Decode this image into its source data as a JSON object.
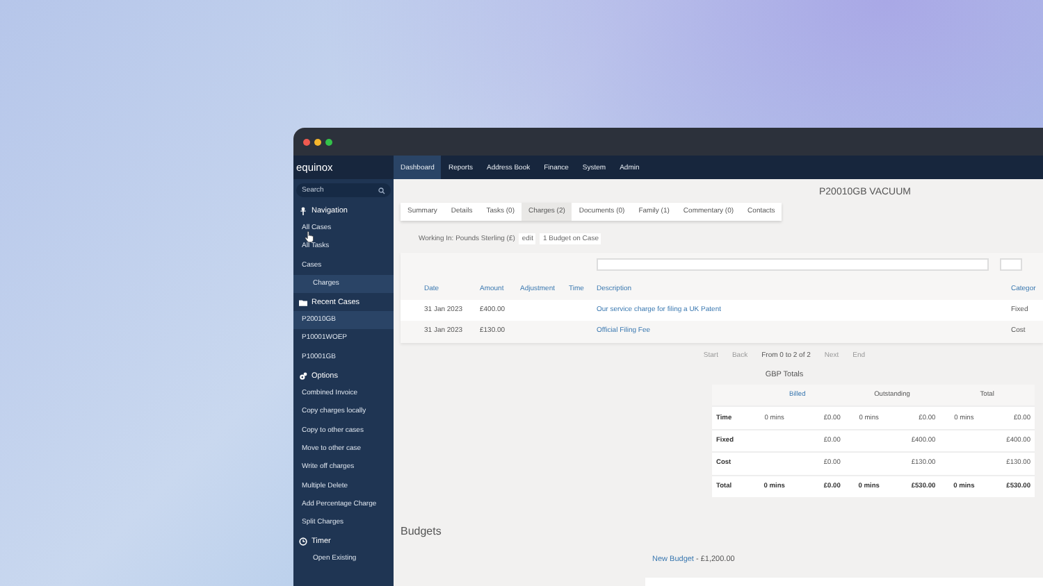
{
  "sidebar": {
    "logo": "equinox",
    "search": {
      "placeholder": "Search"
    },
    "sections": [
      {
        "kind": "navigation",
        "title": "Navigation",
        "items": [
          {
            "label": "All Cases",
            "selected": false,
            "indent": false
          },
          {
            "label": "All Tasks",
            "selected": false,
            "indent": false
          },
          {
            "label": "Cases",
            "selected": false,
            "indent": false
          },
          {
            "label": "Charges",
            "selected": true,
            "indent": true
          }
        ]
      },
      {
        "kind": "folder",
        "title": "Recent Cases",
        "items": [
          {
            "label": "P20010GB",
            "selected": true,
            "indent": false
          },
          {
            "label": "P10001WOEP",
            "selected": false,
            "indent": false
          },
          {
            "label": "P10001GB",
            "selected": false,
            "indent": false
          }
        ]
      },
      {
        "kind": "options",
        "title": "Options",
        "items": [
          {
            "label": "Combined Invoice",
            "selected": false,
            "indent": false
          },
          {
            "label": "Copy charges locally",
            "selected": false,
            "indent": false
          },
          {
            "label": "Copy to other cases",
            "selected": false,
            "indent": false
          },
          {
            "label": "Move to other case",
            "selected": false,
            "indent": false
          },
          {
            "label": "Write off charges",
            "selected": false,
            "indent": false
          },
          {
            "label": "Multiple Delete",
            "selected": false,
            "indent": false
          },
          {
            "label": "Add Percentage Charge",
            "selected": false,
            "indent": false
          },
          {
            "label": "Split Charges",
            "selected": false,
            "indent": false
          }
        ]
      },
      {
        "kind": "timer",
        "title": "Timer",
        "items": [
          {
            "label": "Open Existing",
            "selected": false,
            "indent": true
          }
        ]
      }
    ]
  },
  "top_nav": [
    {
      "label": "Dashboard",
      "selected": true
    },
    {
      "label": "Reports",
      "selected": false
    },
    {
      "label": "Address Book",
      "selected": false
    },
    {
      "label": "Finance",
      "selected": false
    },
    {
      "label": "System",
      "selected": false
    },
    {
      "label": "Admin",
      "selected": false
    }
  ],
  "case_title": "P20010GB VACUUM",
  "tabs": [
    {
      "label": "Summary",
      "selected": false
    },
    {
      "label": "Details",
      "selected": false
    },
    {
      "label": "Tasks (0)",
      "selected": false
    },
    {
      "label": "Charges (2)",
      "selected": true
    },
    {
      "label": "Documents (0)",
      "selected": false
    },
    {
      "label": "Family (1)",
      "selected": false
    },
    {
      "label": "Commentary (0)",
      "selected": false
    },
    {
      "label": "Contacts",
      "selected": false
    }
  ],
  "working_in": {
    "text": "Working In: Pounds Sterling (£)",
    "edit": "edit",
    "budget": "1 Budget on Case"
  },
  "charges": {
    "columns": [
      "Date",
      "Amount",
      "Adjustment",
      "Time",
      "Description",
      "Categor"
    ],
    "rows": [
      [
        "31 Jan 2023",
        "£400.00",
        "",
        "",
        "Our service charge for filing a UK Patent",
        "Fixed"
      ],
      [
        "31 Jan 2023",
        "£130.00",
        "",
        "",
        "Official Filing Fee",
        "Cost"
      ]
    ]
  },
  "pagination": [
    {
      "label": "Start",
      "disabled": true
    },
    {
      "label": "Back",
      "disabled": true
    },
    {
      "label": "From 0 to 2 of 2",
      "disabled": false
    },
    {
      "label": "Next",
      "disabled": true
    },
    {
      "label": "End",
      "disabled": true
    }
  ],
  "totals": {
    "title": "GBP Totals",
    "groups": [
      {
        "label": "Billed",
        "link": true
      },
      {
        "label": "Outstanding",
        "link": false
      },
      {
        "label": "Total",
        "link": false
      }
    ],
    "rows": [
      {
        "label": "Time",
        "bold": false,
        "cells": [
          "0 mins",
          "£0.00",
          "0 mins",
          "£0.00",
          "0 mins",
          "£0.00"
        ]
      },
      {
        "label": "Fixed",
        "bold": false,
        "cells": [
          "",
          "£0.00",
          "",
          "£400.00",
          "",
          "£400.00"
        ]
      },
      {
        "label": "Cost",
        "bold": false,
        "cells": [
          "",
          "£0.00",
          "",
          "£130.00",
          "",
          "£130.00"
        ]
      },
      {
        "label": "Total",
        "bold": true,
        "cells": [
          "0 mins",
          "£0.00",
          "0 mins",
          "£530.00",
          "0 mins",
          "£530.00"
        ]
      }
    ]
  },
  "budgets": {
    "title": "Budgets",
    "name": "New Budget",
    "amount": " - £1,200.00"
  }
}
